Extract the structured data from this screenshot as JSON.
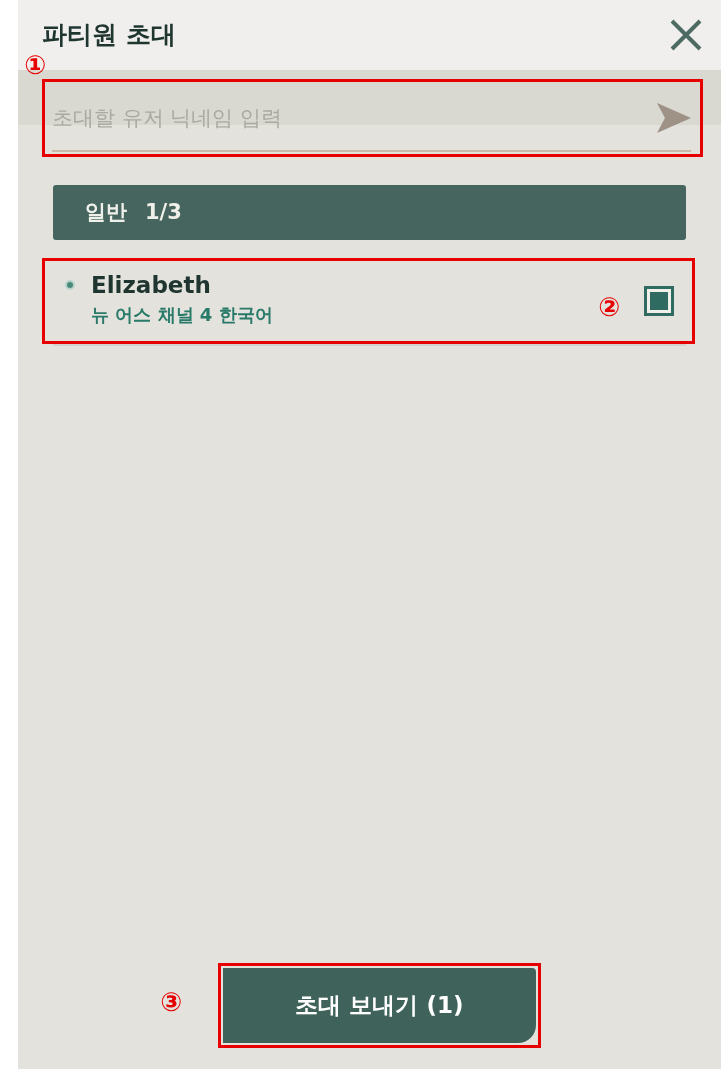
{
  "title": "파티원 초대",
  "annotations": [
    "①",
    "②",
    "③"
  ],
  "search": {
    "placeholder": "초대할 유저 닉네임 입력"
  },
  "group": {
    "label": "일반",
    "count": "1/3"
  },
  "members": [
    {
      "name": "Elizabeth",
      "channel": "뉴 어스 채널 4 한국어",
      "online": true,
      "selected": true
    }
  ],
  "send_button": "초대 보내기 (1)"
}
